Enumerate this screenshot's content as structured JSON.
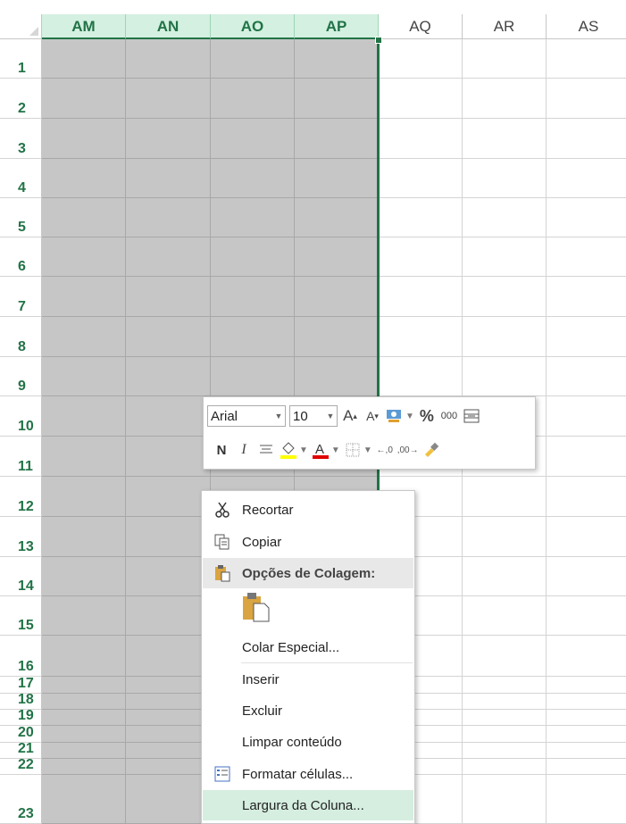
{
  "sheet": {
    "columns": [
      {
        "label": "AM",
        "selected": true
      },
      {
        "label": "AN",
        "selected": true
      },
      {
        "label": "AO",
        "selected": true
      },
      {
        "label": "AP",
        "selected": true
      },
      {
        "label": "AQ",
        "selected": false
      },
      {
        "label": "AR",
        "selected": false
      },
      {
        "label": "AS",
        "selected": false
      }
    ],
    "rows": [
      "1",
      "2",
      "3",
      "4",
      "5",
      "6",
      "7",
      "8",
      "9",
      "10",
      "11",
      "12",
      "13",
      "14",
      "15",
      "16",
      "17",
      "18",
      "19",
      "20",
      "21",
      "22",
      "23"
    ],
    "colors": {
      "selected_header_bg": "#d3f0e0",
      "selected_fill": "#c6c6c6",
      "accent": "#217346"
    }
  },
  "mini_toolbar": {
    "font_name": "Arial",
    "font_size": "10",
    "grow_font_icon": "font-grow-icon",
    "shrink_font_icon": "font-shrink-icon",
    "percent_label": "%",
    "thousands_label": "000",
    "bold_label": "N",
    "italic_label": "I"
  },
  "context_menu": {
    "items": [
      {
        "label": "Recortar",
        "icon": "scissors-icon"
      },
      {
        "label": "Copiar",
        "icon": "copy-icon"
      },
      {
        "label": "Opções de Colagem:",
        "icon": "paste-options-icon"
      },
      {
        "label": "Colar Especial...",
        "icon": ""
      },
      {
        "label": "Inserir",
        "icon": ""
      },
      {
        "label": "Excluir",
        "icon": ""
      },
      {
        "label": "Limpar conteúdo",
        "icon": ""
      },
      {
        "label": "Formatar células...",
        "icon": "format-cells-icon"
      },
      {
        "label": "Largura da Coluna...",
        "icon": ""
      }
    ]
  }
}
